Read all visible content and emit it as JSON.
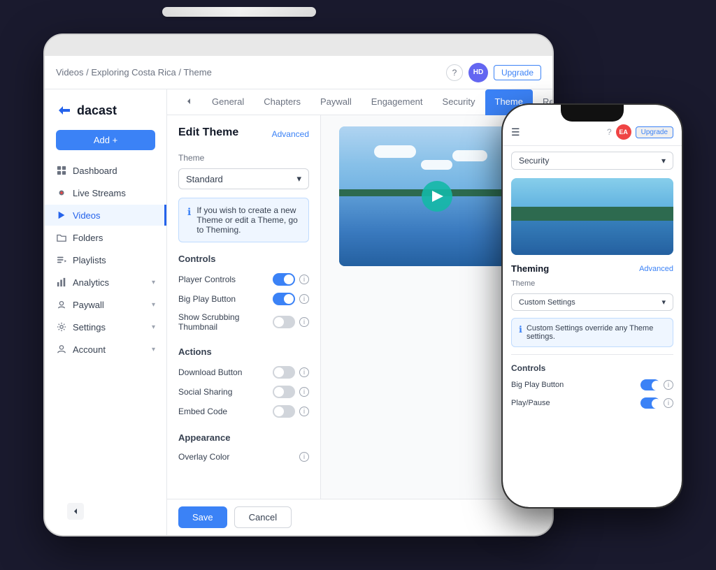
{
  "scene": {
    "background": "#1a1a2e"
  },
  "tablet": {
    "header": {
      "breadcrumb": "Videos / Exploring Costa Rica / Theme",
      "help_label": "?",
      "avatar": "HD",
      "upgrade_label": "Upgrade"
    },
    "sidebar": {
      "logo_text": "dacast",
      "add_button": "Add +",
      "nav_items": [
        {
          "label": "Dashboard",
          "icon": "dashboard-icon",
          "active": false
        },
        {
          "label": "Live Streams",
          "icon": "livestream-icon",
          "active": false
        },
        {
          "label": "Videos",
          "icon": "video-icon",
          "active": true
        },
        {
          "label": "Folders",
          "icon": "folder-icon",
          "active": false
        },
        {
          "label": "Playlists",
          "icon": "playlist-icon",
          "active": false
        },
        {
          "label": "Analytics",
          "icon": "analytics-icon",
          "active": false,
          "arrow": "▾"
        },
        {
          "label": "Paywall",
          "icon": "paywall-icon",
          "active": false,
          "arrow": "▾"
        },
        {
          "label": "Settings",
          "icon": "settings-icon",
          "active": false,
          "arrow": "▾"
        },
        {
          "label": "Account",
          "icon": "account-icon",
          "active": false,
          "arrow": "▾"
        }
      ]
    },
    "tabs": [
      {
        "label": "General",
        "active": false
      },
      {
        "label": "Chapters",
        "active": false
      },
      {
        "label": "Paywall",
        "active": false
      },
      {
        "label": "Engagement",
        "active": false
      },
      {
        "label": "Security",
        "active": false
      },
      {
        "label": "Theme",
        "active": true
      },
      {
        "label": "Renditions",
        "active": false
      }
    ],
    "left_panel": {
      "title": "Edit Theme",
      "advanced_link": "Advanced",
      "theme_label": "Theme",
      "theme_select": "Standard",
      "info_text": "If you wish to create a new Theme or edit a Theme, go to Theming.",
      "controls_heading": "Controls",
      "controls": [
        {
          "label": "Player Controls",
          "on": true
        },
        {
          "label": "Big Play Button",
          "on": true
        },
        {
          "label": "Show Scrubbing Thumbnail",
          "on": false
        }
      ],
      "actions_heading": "Actions",
      "actions": [
        {
          "label": "Download Button",
          "on": false
        },
        {
          "label": "Social Sharing",
          "on": false
        },
        {
          "label": "Embed Code",
          "on": false
        }
      ],
      "appearance_heading": "Appearance",
      "appearance_items": [
        {
          "label": "Overlay Color",
          "on": false
        }
      ]
    },
    "footer": {
      "save_label": "Save",
      "cancel_label": "Cancel"
    }
  },
  "phone": {
    "header": {
      "help_label": "?",
      "avatar": "EA",
      "upgrade_label": "Upgrade"
    },
    "security_select": "Security",
    "theming": {
      "section_title": "Theming",
      "advanced_link": "Advanced",
      "theme_label": "Theme",
      "theme_select": "Custom Settings",
      "info_text": "Custom Settings override any Theme settings."
    },
    "controls_heading": "Controls",
    "controls": [
      {
        "label": "Big Play Button",
        "on": true
      },
      {
        "label": "Play/Pause",
        "on": true
      }
    ]
  }
}
